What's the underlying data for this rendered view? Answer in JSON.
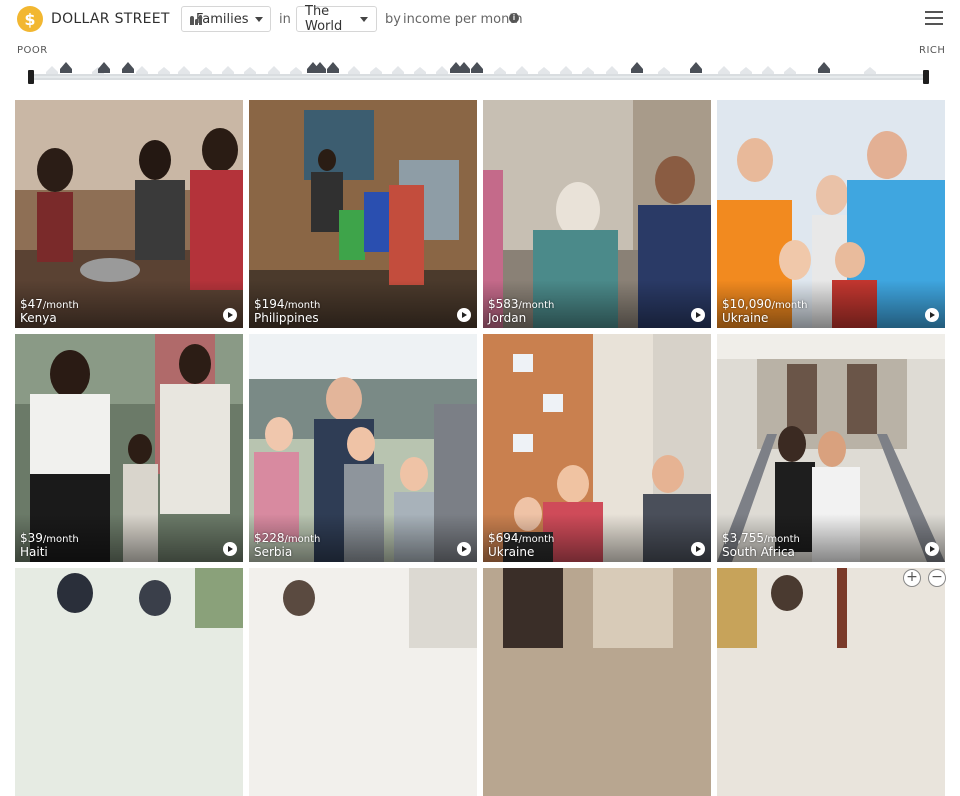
{
  "header": {
    "logo_glyph": "$",
    "brand": "DOLLAR STREET",
    "families_label": "Families",
    "in_text": "in",
    "world_label": "The World",
    "by_text": "by",
    "income_text": "income per month",
    "info_glyph": "i"
  },
  "scale": {
    "poor_label": "POOR",
    "rich_label": "RICH"
  },
  "tiles": [
    {
      "amount": "$47",
      "unit": "/month",
      "country": "Kenya"
    },
    {
      "amount": "$194",
      "unit": "/month",
      "country": "Philippines"
    },
    {
      "amount": "$583",
      "unit": "/month",
      "country": "Jordan"
    },
    {
      "amount": "$10,090",
      "unit": "/month",
      "country": "Ukraine"
    },
    {
      "amount": "$39",
      "unit": "/month",
      "country": "Haiti"
    },
    {
      "amount": "$228",
      "unit": "/month",
      "country": "Serbia"
    },
    {
      "amount": "$694",
      "unit": "/month",
      "country": "Ukraine"
    },
    {
      "amount": "$3,755",
      "unit": "/month",
      "country": "South Africa"
    }
  ],
  "zoom": {
    "in": "+",
    "out": "−"
  },
  "colors": {
    "logo": "#f2b731",
    "scale_bar": "#d9dde0",
    "house": "#4a4f57"
  }
}
